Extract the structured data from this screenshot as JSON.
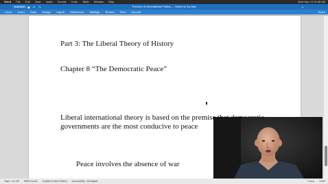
{
  "menubar": {
    "app": "Word",
    "items": [
      "File",
      "Edit",
      "View",
      "Insert",
      "Format",
      "Tools",
      "Table",
      "Window",
      "Help"
    ],
    "clock": "Wed Sep 13 10:08 AM"
  },
  "titlebar": {
    "autosave": "AutoSave",
    "doc_title": "Theories of International Politics — Saved to my Mac"
  },
  "ribbon": {
    "tabs": [
      "Home",
      "Insert",
      "Draw",
      "Design",
      "Layout",
      "References",
      "Mailings",
      "Review",
      "View",
      "Acrobat"
    ],
    "account": "Share"
  },
  "document": {
    "line1": "Part 3: The Liberal Theory of History",
    "line2": "Chapter 8 “The Democratic Peace”",
    "line3": "Liberal international theory is based on the premise that democratic",
    "line4": "governments are the most conducive to peace",
    "line5": "Peace involves the absence of war"
  },
  "statusbar": {
    "page": "Page 1 of 155",
    "words": "58504 words",
    "language": "English (United States)",
    "accessibility": "Accessibility: Investigate",
    "focus": "Focus",
    "zoom": "200%"
  }
}
